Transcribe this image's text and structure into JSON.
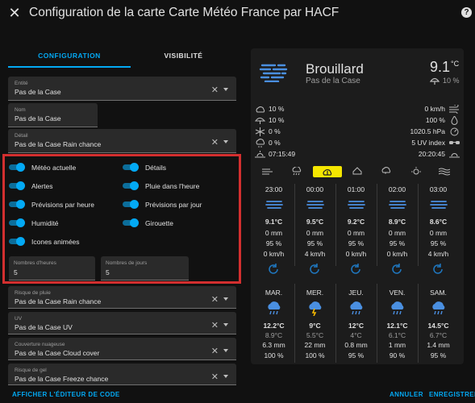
{
  "header": {
    "title": "Configuration de la carte Carte Météo France par HACF",
    "close_icon": "close-icon",
    "help_icon": "help-icon"
  },
  "tabs": [
    {
      "label": "CONFIGURATION"
    },
    {
      "label": "VISIBILITÉ"
    }
  ],
  "fields": {
    "entite": {
      "label": "Entité",
      "value": "Pas de la Case"
    },
    "nom": {
      "label": "Nom",
      "value": "Pas de la Case"
    },
    "detail": {
      "label": "Détail",
      "value": "Pas de la Case Rain chance"
    },
    "risque_pluie": {
      "label": "Risque de pluie",
      "value": "Pas de la Case Rain chance"
    },
    "uv": {
      "label": "UV",
      "value": "Pas de la Case UV"
    },
    "couverture": {
      "label": "Couverture nuageuse",
      "value": "Pas de la Case Cloud cover"
    },
    "risque_gel": {
      "label": "Risque de gel",
      "value": "Pas de la Case Freeze chance"
    }
  },
  "toggles": [
    {
      "label": "Météo actuelle",
      "checked": true
    },
    {
      "label": "Détails",
      "checked": true
    },
    {
      "label": "Alertes",
      "checked": true
    },
    {
      "label": "Pluie dans l'heure",
      "checked": true
    },
    {
      "label": "Prévisions par heure",
      "checked": true
    },
    {
      "label": "Prévisions par jour",
      "checked": true
    },
    {
      "label": "Humidité",
      "checked": true
    },
    {
      "label": "Girouette",
      "checked": true
    },
    {
      "label": "Icones animées",
      "checked": true
    }
  ],
  "counts": {
    "heures": {
      "label": "Nombres d'heures",
      "value": "5"
    },
    "jours": {
      "label": "Nombres de jours",
      "value": "5"
    }
  },
  "buttons": {
    "show_code": "AFFICHER L'ÉDITEUR DE CODE",
    "cancel": "ANNULER",
    "save": "ENREGISTRER"
  },
  "card": {
    "condition": "Brouillard",
    "location": "Pas de la Case",
    "temperature": "9.1",
    "temp_unit": "°C",
    "rain_chance": "10 %",
    "details_left": [
      "10 %",
      "10 %",
      "0 %",
      "0 %",
      "07:15:49"
    ],
    "details_right": [
      "0 km/h",
      "100 %",
      "1020.5 hPa",
      "5 UV index",
      "20:20:45"
    ],
    "hourly": [
      {
        "time": "23:00",
        "temp": "9.1°C",
        "rain": "0 mm",
        "humidity": "95 %",
        "wind": "0 km/h"
      },
      {
        "time": "00:00",
        "temp": "9.5°C",
        "rain": "0 mm",
        "humidity": "95 %",
        "wind": "4 km/h"
      },
      {
        "time": "01:00",
        "temp": "9.2°C",
        "rain": "0 mm",
        "humidity": "95 %",
        "wind": "0 km/h"
      },
      {
        "time": "02:00",
        "temp": "8.9°C",
        "rain": "0 mm",
        "humidity": "95 %",
        "wind": "0 km/h"
      },
      {
        "time": "03:00",
        "temp": "8.6°C",
        "rain": "0 mm",
        "humidity": "95 %",
        "wind": "4 km/h"
      }
    ],
    "daily": [
      {
        "day": "MAR.",
        "max": "12.2°C",
        "min": "8.9°C",
        "rain": "6.3 mm",
        "humidity": "100 %"
      },
      {
        "day": "MER.",
        "max": "9°C",
        "min": "5.5°C",
        "rain": "22 mm",
        "humidity": "100 %"
      },
      {
        "day": "JEU.",
        "max": "12°C",
        "min": "4°C",
        "rain": "0.8 mm",
        "humidity": "95 %"
      },
      {
        "day": "VEN.",
        "max": "12.1°C",
        "min": "6.1°C",
        "rain": "1 mm",
        "humidity": "90 %"
      },
      {
        "day": "SAM.",
        "max": "14.5°C",
        "min": "6.7°C",
        "rain": "1.4 mm",
        "humidity": "95 %"
      }
    ]
  },
  "colors": {
    "accent": "#03a9f4",
    "highlight_box": "#d32f2f",
    "rain_alert": "#f5e600",
    "icon_blue": "#4a8fe0"
  }
}
